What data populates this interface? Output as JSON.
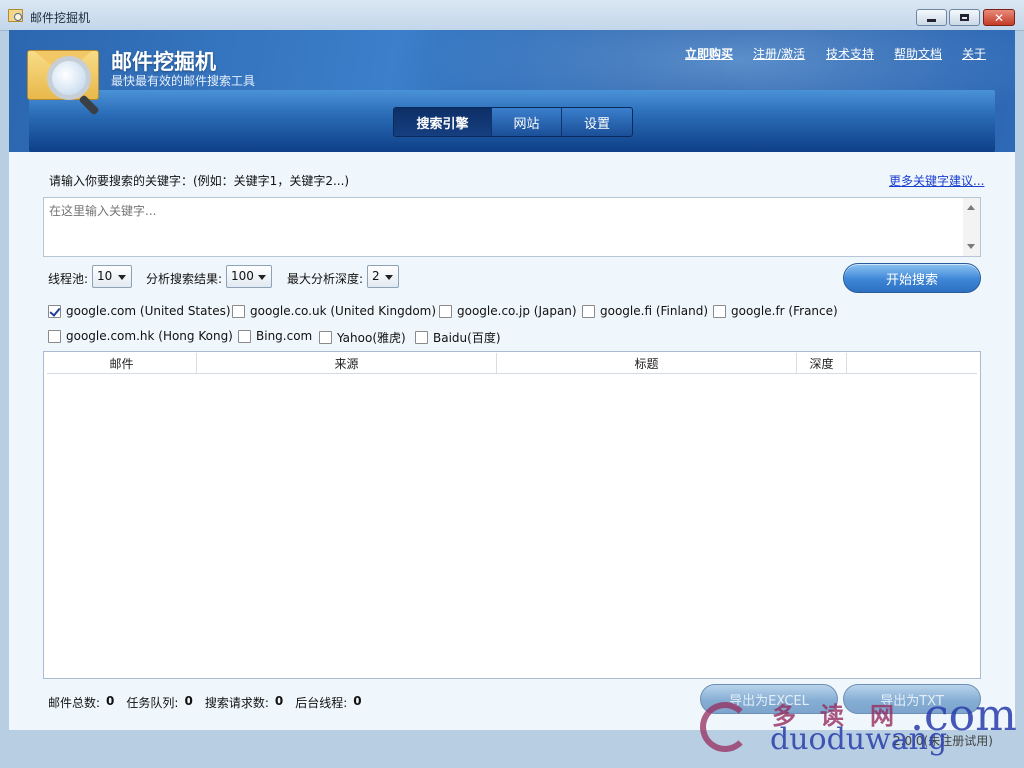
{
  "window": {
    "title": "邮件挖掘机"
  },
  "header": {
    "app_name": "邮件挖掘机",
    "tagline": "最快最有效的邮件搜索工具",
    "links": [
      {
        "label": "立即购买",
        "bold": true
      },
      {
        "label": "注册/激活"
      },
      {
        "label": "技术支持"
      },
      {
        "label": "帮助文档"
      },
      {
        "label": "关于"
      }
    ],
    "tabs": [
      {
        "label": "搜索引擎",
        "active": true
      },
      {
        "label": "网站",
        "active": false
      },
      {
        "label": "设置",
        "active": false
      }
    ]
  },
  "keywords": {
    "label": "请输入你要搜索的关键字：(例如：关键字1，关键字2...)",
    "more_link": "更多关键字建议...",
    "placeholder": "在这里输入关键字..."
  },
  "options": {
    "threads_label": "线程池:",
    "threads_value": "10",
    "results_label": "分析搜索结果:",
    "results_value": "100",
    "depth_label": "最大分析深度:",
    "depth_value": "2",
    "start_button": "开始搜索"
  },
  "engines": [
    {
      "label": "google.com (United States)",
      "checked": true
    },
    {
      "label": "google.co.uk (United Kingdom)",
      "checked": false
    },
    {
      "label": "google.co.jp (Japan)",
      "checked": false
    },
    {
      "label": "google.fi (Finland)",
      "checked": false
    },
    {
      "label": "google.fr (France)",
      "checked": false
    },
    {
      "label": "google.com.hk (Hong Kong)",
      "checked": false
    },
    {
      "label": "Bing.com",
      "checked": false
    },
    {
      "label": "Yahoo(雅虎)",
      "checked": false
    },
    {
      "label": "Baidu(百度)",
      "checked": false
    }
  ],
  "grid": {
    "columns": [
      "邮件",
      "来源",
      "标题",
      "深度"
    ],
    "rows": []
  },
  "stats": {
    "total_label": "邮件总数:",
    "total_value": "0",
    "queue_label": "任务队列:",
    "queue_value": "0",
    "requests_label": "搜索请求数:",
    "requests_value": "0",
    "threads_label": "后台线程:",
    "threads_value": "0"
  },
  "export": {
    "excel_button": "导出为EXCEL",
    "txt_button": "导出为TXT"
  },
  "version": "2.0.0(未注册试用)",
  "watermark": {
    "cn": [
      "多",
      "读",
      "网"
    ],
    "url": "duoduwang",
    "tld": ".com"
  },
  "colors": {
    "banner": "#2c66b0",
    "accent_button": "#3e86d6",
    "link": "#1a3fcf",
    "close_button": "#c33b27"
  }
}
